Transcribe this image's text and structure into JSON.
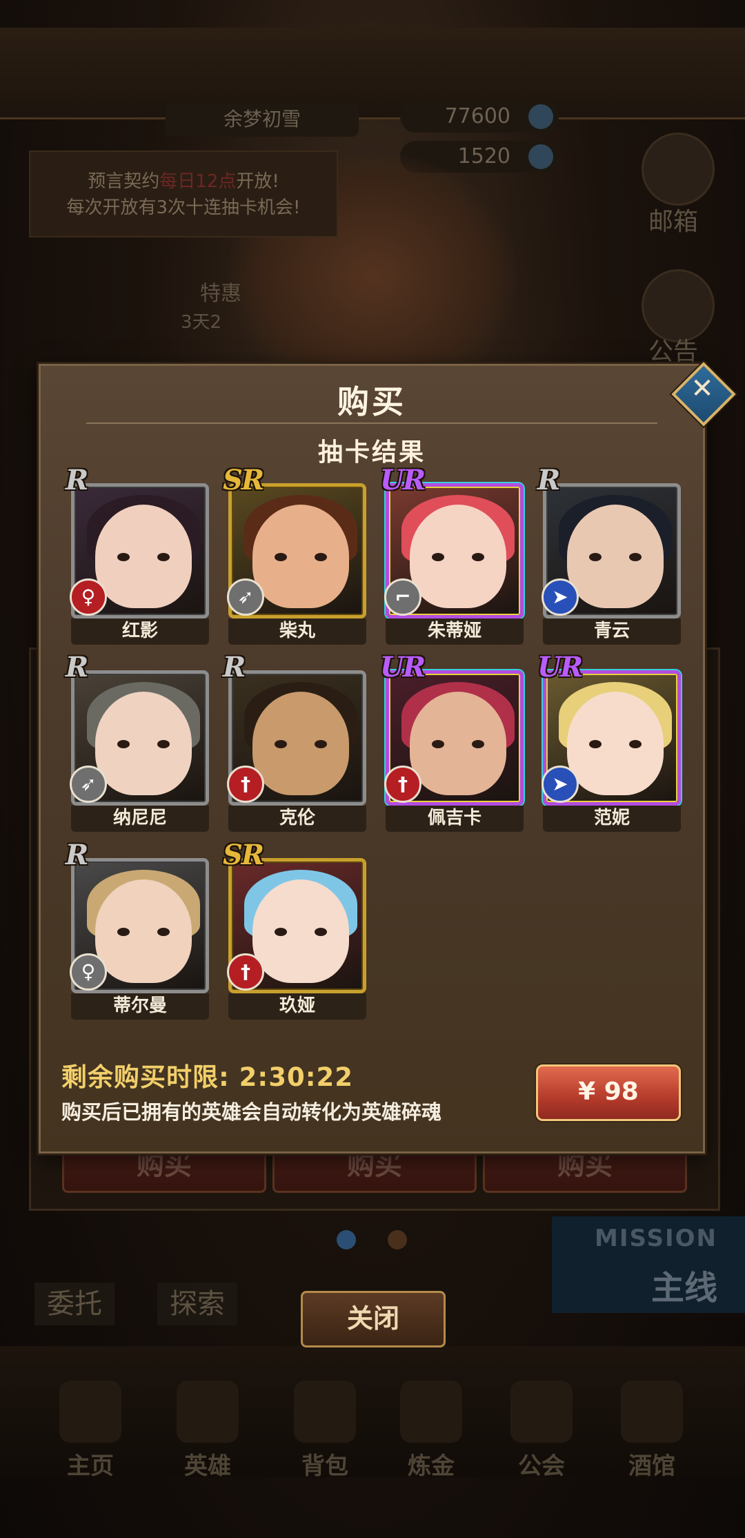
{
  "background": {
    "player_name": "余梦初雪",
    "currency_gold": "77600",
    "currency_gems": "1520",
    "notice_line1_a": "预言契约",
    "notice_line1_b": "每日12点",
    "notice_line1_c": "开放!",
    "notice_line2": "每次开放有3次十连抽卡机会!",
    "mailbox_label": "邮箱",
    "announcement_label": "公告",
    "event_label": "特惠",
    "event_timer": "3天2",
    "buy_buttons": [
      "购买",
      "购买",
      "购买"
    ],
    "mission_en": "MISSION",
    "mission_cn": "主线",
    "task_entrust": "委托",
    "task_explore": "探索",
    "nav": [
      "主页",
      "英雄",
      "背包",
      "炼金",
      "公会",
      "酒馆"
    ]
  },
  "modal": {
    "title": "购买",
    "subtitle": "抽卡结果",
    "close_icon": "close-x-icon",
    "cards": [
      {
        "rarity": "R",
        "name": "红影",
        "class_icon": "staff-icon",
        "class_color": "red"
      },
      {
        "rarity": "SR",
        "name": "柴丸",
        "class_icon": "bow-icon",
        "class_color": "gray"
      },
      {
        "rarity": "UR",
        "name": "朱蒂娅",
        "class_icon": "gun-icon",
        "class_color": "gray"
      },
      {
        "rarity": "R",
        "name": "青云",
        "class_icon": "lance-icon",
        "class_color": "blue"
      },
      {
        "rarity": "R",
        "name": "纳尼尼",
        "class_icon": "bow-icon",
        "class_color": "gray"
      },
      {
        "rarity": "R",
        "name": "克伦",
        "class_icon": "sword-icon",
        "class_color": "red"
      },
      {
        "rarity": "UR",
        "name": "佩吉卡",
        "class_icon": "sword-icon",
        "class_color": "red"
      },
      {
        "rarity": "UR",
        "name": "范妮",
        "class_icon": "lance-icon",
        "class_color": "blue"
      },
      {
        "rarity": "R",
        "name": "蒂尔曼",
        "class_icon": "staff-icon",
        "class_color": "gray"
      },
      {
        "rarity": "SR",
        "name": "玖娅",
        "class_icon": "sword-icon",
        "class_color": "red"
      }
    ],
    "timer_text": "剩余购买时限: 2:30:22",
    "note": "购买后已拥有的英雄会自动转化为英雄碎魂",
    "price": "¥ 98"
  },
  "close_button": "关闭",
  "colors": {
    "rarity_r": "#c9c9c9",
    "rarity_sr": "#e6b83a",
    "rarity_ur": "#b95cff",
    "price_button": "#c94c37"
  }
}
